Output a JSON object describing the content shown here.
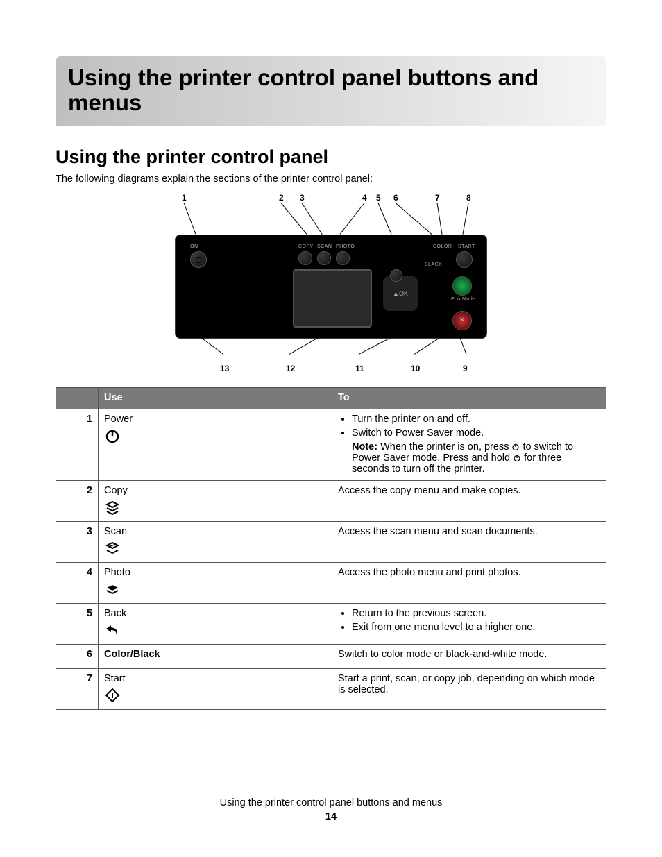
{
  "chapter_title": "Using the printer control panel buttons and menus",
  "section_title": "Using the printer control panel",
  "intro": "The following diagrams explain the sections of the printer control panel:",
  "diagram": {
    "top_callouts": [
      "1",
      "2",
      "3",
      "4",
      "5",
      "6",
      "7",
      "8"
    ],
    "bottom_callouts": [
      "13",
      "12",
      "11",
      "10",
      "9"
    ],
    "panel_labels": {
      "on": "ON",
      "copy": "COPY",
      "scan": "SCAN",
      "photo": "PHOTO",
      "color": "COLOR",
      "start": "START",
      "black": "BLACK",
      "eco": "Eco Mode",
      "ok": "OK"
    }
  },
  "table": {
    "headers": {
      "num": "",
      "use": "Use",
      "to": "To"
    },
    "rows": [
      {
        "num": "1",
        "use": "Power",
        "icon": "power-icon",
        "to_list": [
          "Turn the printer on and off.",
          "Switch to Power Saver mode."
        ],
        "note": {
          "prefix": "Note:",
          "part1": " When the printer is on, press ",
          "mid": " to switch to Power Saver mode. Press and hold ",
          "part2": " for three seconds to turn off the printer."
        }
      },
      {
        "num": "2",
        "use": "Copy",
        "icon": "copy-icon",
        "to_text": "Access the copy menu and make copies."
      },
      {
        "num": "3",
        "use": "Scan",
        "icon": "scan-icon",
        "to_text": "Access the scan menu and scan documents."
      },
      {
        "num": "4",
        "use": "Photo",
        "icon": "photo-icon",
        "to_text": "Access the photo menu and print photos."
      },
      {
        "num": "5",
        "use": "Back",
        "icon": "back-icon",
        "to_list": [
          "Return to the previous screen.",
          "Exit from one menu level to a higher one."
        ]
      },
      {
        "num": "6",
        "use": "Color/Black",
        "use_bold": true,
        "to_text": "Switch to color mode or black-and-white mode."
      },
      {
        "num": "7",
        "use": "Start",
        "icon": "start-icon",
        "to_text": "Start a print, scan, or copy job, depending on which mode is selected."
      }
    ]
  },
  "footer": {
    "title": "Using the printer control panel buttons and menus",
    "page": "14"
  }
}
